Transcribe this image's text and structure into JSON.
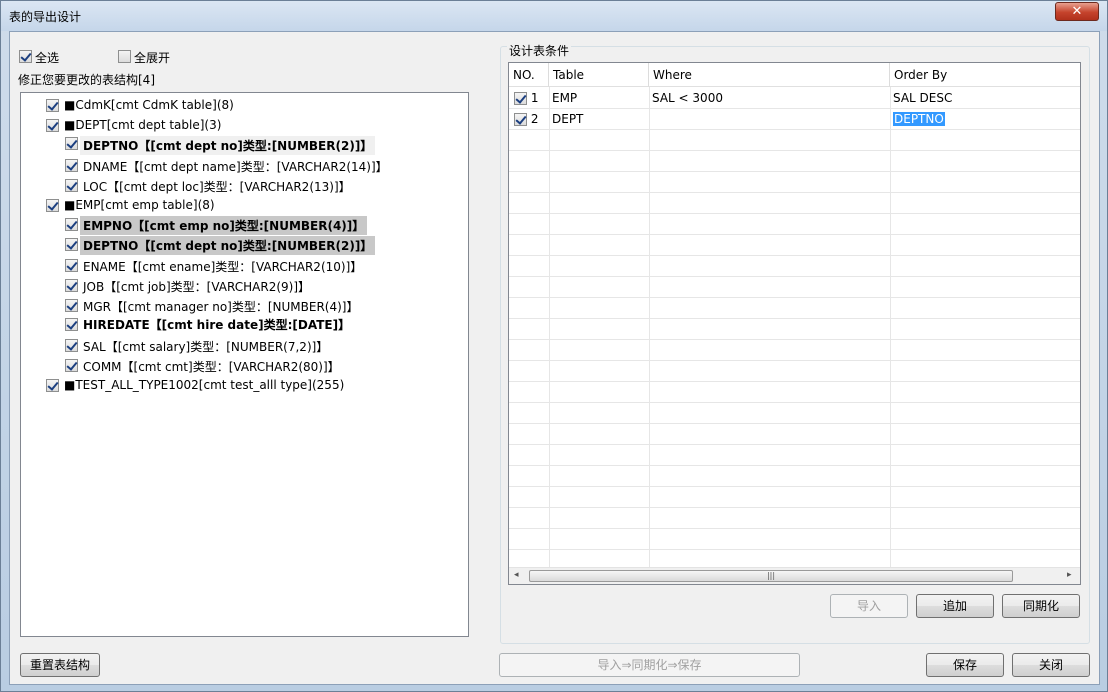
{
  "window": {
    "title": "表的导出设计",
    "close_label": "✕"
  },
  "top": {
    "select_all": "全选",
    "expand_all": "全展开",
    "tree_caption": "修正您要更改的表结构[4]"
  },
  "tree": [
    {
      "label": "■CdmK[cmt CdmK table](8)"
    },
    {
      "label": "■DEPT[cmt dept table](3)"
    },
    {
      "label": "DEPTNO【[cmt dept no]类型:[NUMBER(2)]】"
    },
    {
      "label": "DNAME【[cmt dept name]类型：[VARCHAR2(14)]】"
    },
    {
      "label": "LOC【[cmt dept loc]类型：[VARCHAR2(13)]】"
    },
    {
      "label": "■EMP[cmt emp table](8)"
    },
    {
      "label": "EMPNO【[cmt emp no]类型:[NUMBER(4)]】"
    },
    {
      "label": "DEPTNO【[cmt dept no]类型:[NUMBER(2)]】"
    },
    {
      "label": "ENAME【[cmt ename]类型：[VARCHAR2(10)]】"
    },
    {
      "label": "JOB【[cmt job]类型：[VARCHAR2(9)]】"
    },
    {
      "label": "MGR【[cmt manager no]类型：[NUMBER(4)]】"
    },
    {
      "label": "HIREDATE【[cmt hire date]类型:[DATE]】"
    },
    {
      "label": "SAL【[cmt salary]类型：[NUMBER(7,2)]】"
    },
    {
      "label": "COMM【[cmt cmt]类型：[VARCHAR2(80)]】"
    },
    {
      "label": "■TEST_ALL_TYPE1002[cmt test_alll type](255)"
    }
  ],
  "conditions": {
    "caption": "设计表条件",
    "headers": [
      "NO.",
      "Table",
      "Where",
      "Order By"
    ],
    "rows": [
      {
        "no": "1",
        "table": "EMP",
        "where": "SAL < 3000",
        "order": "SAL DESC"
      },
      {
        "no": "2",
        "table": "DEPT",
        "where": "",
        "order": "DEPTNO"
      }
    ],
    "scroll_grip": "|||"
  },
  "buttons": {
    "import": "导入",
    "add": "追加",
    "sync": "同期化",
    "reset": "重置表结构",
    "import_sync_save": "导入⇒同期化⇒保存",
    "save": "保存",
    "close": "关闭"
  }
}
